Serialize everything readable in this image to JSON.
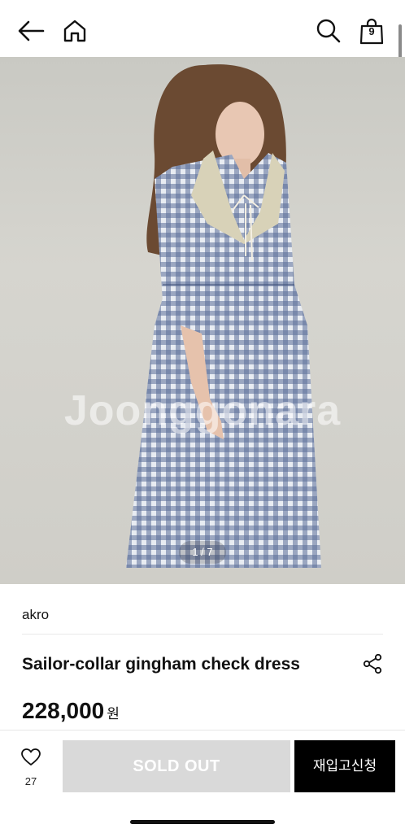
{
  "header": {
    "back_icon": "arrow-left-icon",
    "home_icon": "home-icon",
    "search_icon": "search-icon",
    "cart_icon": "shopping-bag-icon",
    "cart_count": "9"
  },
  "gallery": {
    "watermark": "Joonggonara",
    "page_indicator": "1 / 7"
  },
  "product": {
    "brand": "akro",
    "title": "Sailor-collar gingham check dress",
    "price": "228,000",
    "currency": "원",
    "share_icon": "share-icon"
  },
  "bottom_bar": {
    "like_icon": "heart-icon",
    "like_count": "27",
    "soldout_label": "SOLD OUT",
    "restock_label": "재입고신청"
  },
  "colors": {
    "accent": "#000000",
    "disabled_button": "#d9d9d9",
    "dress_blue": "#4a5f8c"
  }
}
